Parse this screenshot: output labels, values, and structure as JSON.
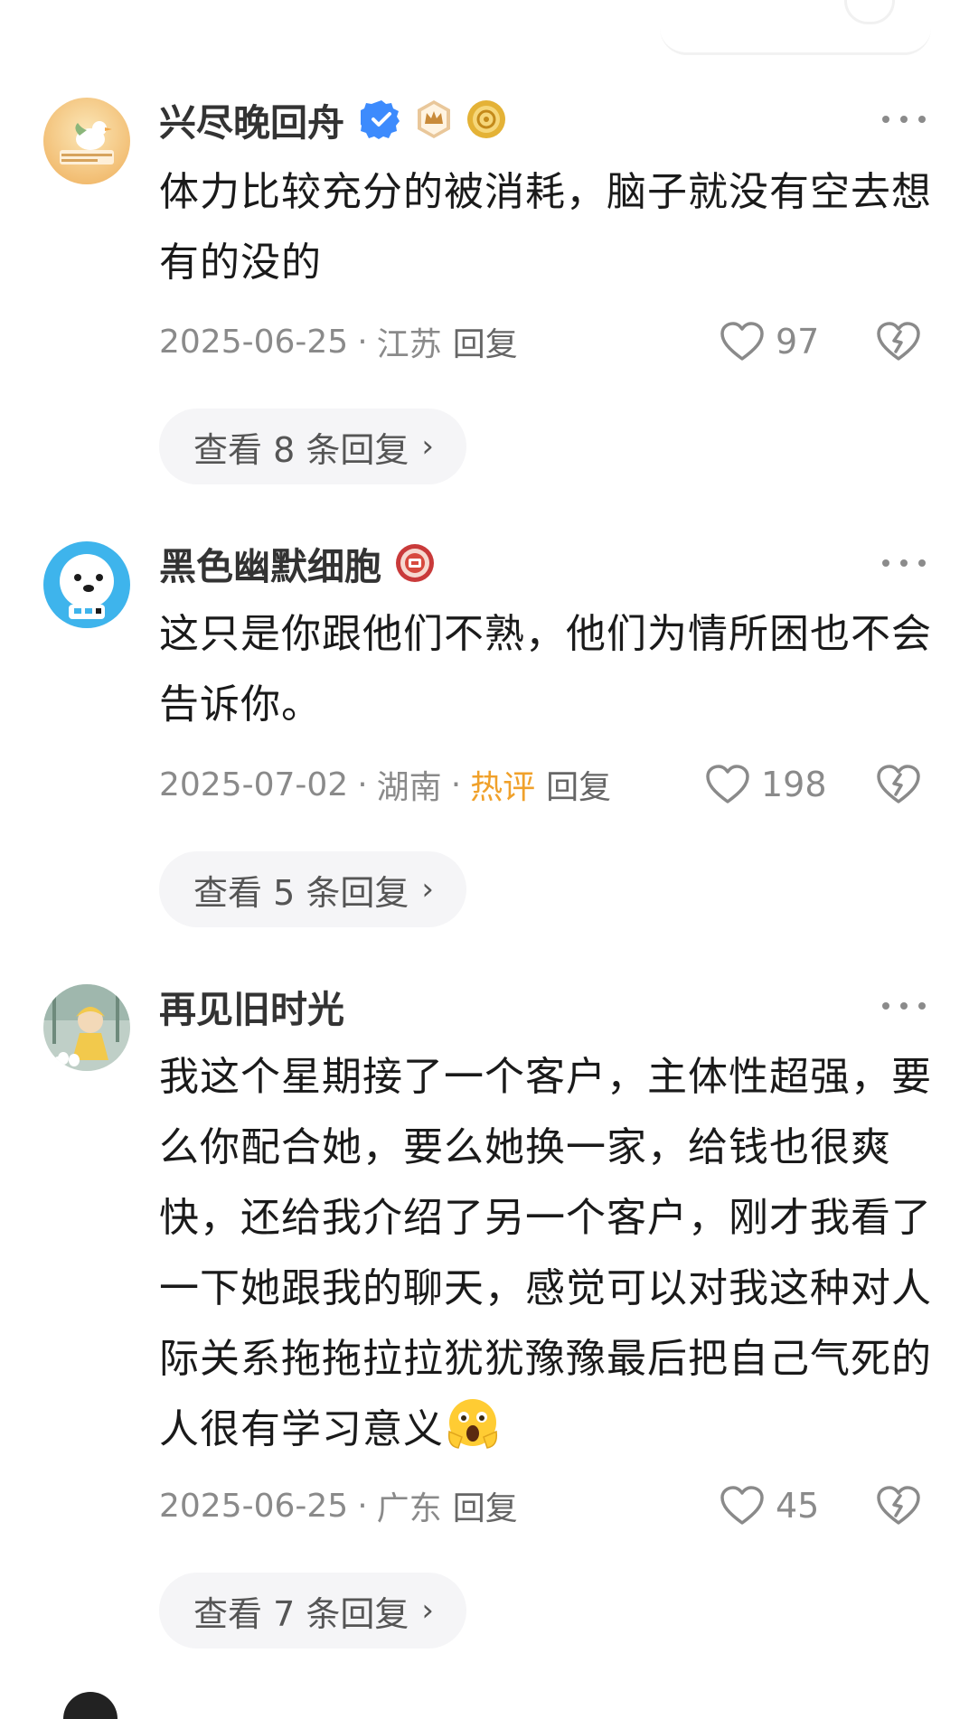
{
  "comments": [
    {
      "username": "兴尽晚回舟",
      "content_lines": [
        "体力比较充分的被消耗，脑子就没有空去想",
        "有的没的"
      ],
      "date": "2025-06-25",
      "separator": "·",
      "location": "江苏",
      "reply_label": "回复",
      "likes": "97",
      "view_replies": "查看 8 条回复",
      "badges": [
        "verified-check-icon",
        "crown-badge-icon",
        "coin-badge-icon"
      ]
    },
    {
      "username": "黑色幽默细胞",
      "content_lines": [
        "这只是你跟他们不熟，他们为情所困也不会",
        "告诉你。"
      ],
      "date": "2025-07-02",
      "separator": "·",
      "location": "湖南",
      "hot_label": "热评",
      "reply_label": "回复",
      "likes": "198",
      "view_replies": "查看 5 条回复",
      "badges": [
        "red-medal-badge-icon"
      ]
    },
    {
      "username": "再见旧时光",
      "content_lines": [
        "我这个星期接了一个客户，主体性超强，要",
        "么你配合她，要么她换一家，给钱也很爽",
        "快，还给我介绍了另一个客户，刚才我看了",
        "一下她跟我的聊天，感觉可以对我这种对人",
        "际关系拖拖拉拉犹犹豫豫最后把自己气死的",
        "人很有学习意义"
      ],
      "content_emoji": "shocked-face-emoji",
      "date": "2025-06-25",
      "separator": "·",
      "location": "广东",
      "reply_label": "回复",
      "likes": "45",
      "view_replies": "查看 7 条回复"
    }
  ],
  "icons": {
    "like": "heart-outline-icon",
    "dislike": "broken-heart-icon",
    "more": "more-dots-icon",
    "chevron": "›"
  },
  "colors": {
    "hot": "#f0a12b",
    "verified": "#3d8bfd",
    "meta": "#8a8a8a",
    "pill_bg": "#f5f5f7"
  }
}
